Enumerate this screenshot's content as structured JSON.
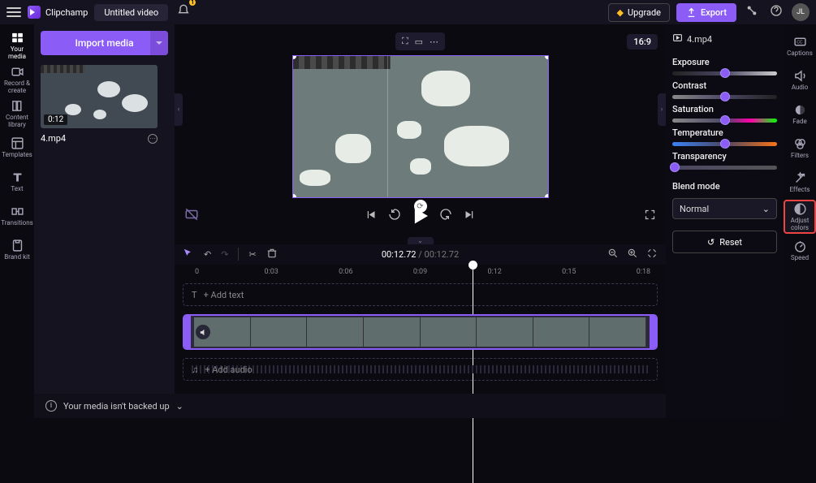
{
  "topbar": {
    "brand": "Clipchamp",
    "title": "Untitled video",
    "notification_count": "1",
    "upgrade_label": "Upgrade",
    "export_label": "Export",
    "avatar_initials": "JL"
  },
  "left_rail": [
    {
      "icon": "media",
      "label": "Your media",
      "active": true
    },
    {
      "icon": "record",
      "label": "Record & create"
    },
    {
      "icon": "library",
      "label": "Content library"
    },
    {
      "icon": "templates",
      "label": "Templates"
    },
    {
      "icon": "text",
      "label": "Text"
    },
    {
      "icon": "transitions",
      "label": "Transitions"
    },
    {
      "icon": "brand",
      "label": "Brand kit"
    }
  ],
  "media_panel": {
    "import_label": "Import media",
    "thumb_duration": "0:12",
    "thumb_name": "4.mp4"
  },
  "stage": {
    "aspect": "16:9"
  },
  "timeline": {
    "current_time": "00:12.72",
    "total_time": "00:12.72",
    "ticks": [
      "0",
      "0:03",
      "0:06",
      "0:09",
      "0:12",
      "0:15",
      "0:18"
    ],
    "text_track_placeholder": "+ Add text",
    "audio_track_placeholder": "+ Add audio"
  },
  "adjust_panel": {
    "file_label": "4.mp4",
    "sliders": [
      {
        "label": "Exposure",
        "pos": 50,
        "class": "sl-exposure"
      },
      {
        "label": "Contrast",
        "pos": 50,
        "class": "sl-contrast"
      },
      {
        "label": "Saturation",
        "pos": 50,
        "class": "sl-saturation"
      },
      {
        "label": "Temperature",
        "pos": 50,
        "class": "sl-temperature"
      },
      {
        "label": "Transparency",
        "pos": 2,
        "class": "sl-transparency"
      }
    ],
    "blend_label": "Blend mode",
    "blend_value": "Normal",
    "reset_label": "Reset"
  },
  "right_rail": [
    {
      "icon": "cc",
      "label": "Captions"
    },
    {
      "icon": "audio",
      "label": "Audio"
    },
    {
      "icon": "fade",
      "label": "Fade"
    },
    {
      "icon": "filters",
      "label": "Filters"
    },
    {
      "icon": "effects",
      "label": "Effects"
    },
    {
      "icon": "adjust",
      "label": "Adjust colors",
      "active": true
    },
    {
      "icon": "speed",
      "label": "Speed"
    }
  ],
  "bottom_bar": {
    "backup_msg": "Your media isn't backed up"
  },
  "colors": {
    "accent": "#8b5cf6",
    "highlight": "#ef4444"
  }
}
